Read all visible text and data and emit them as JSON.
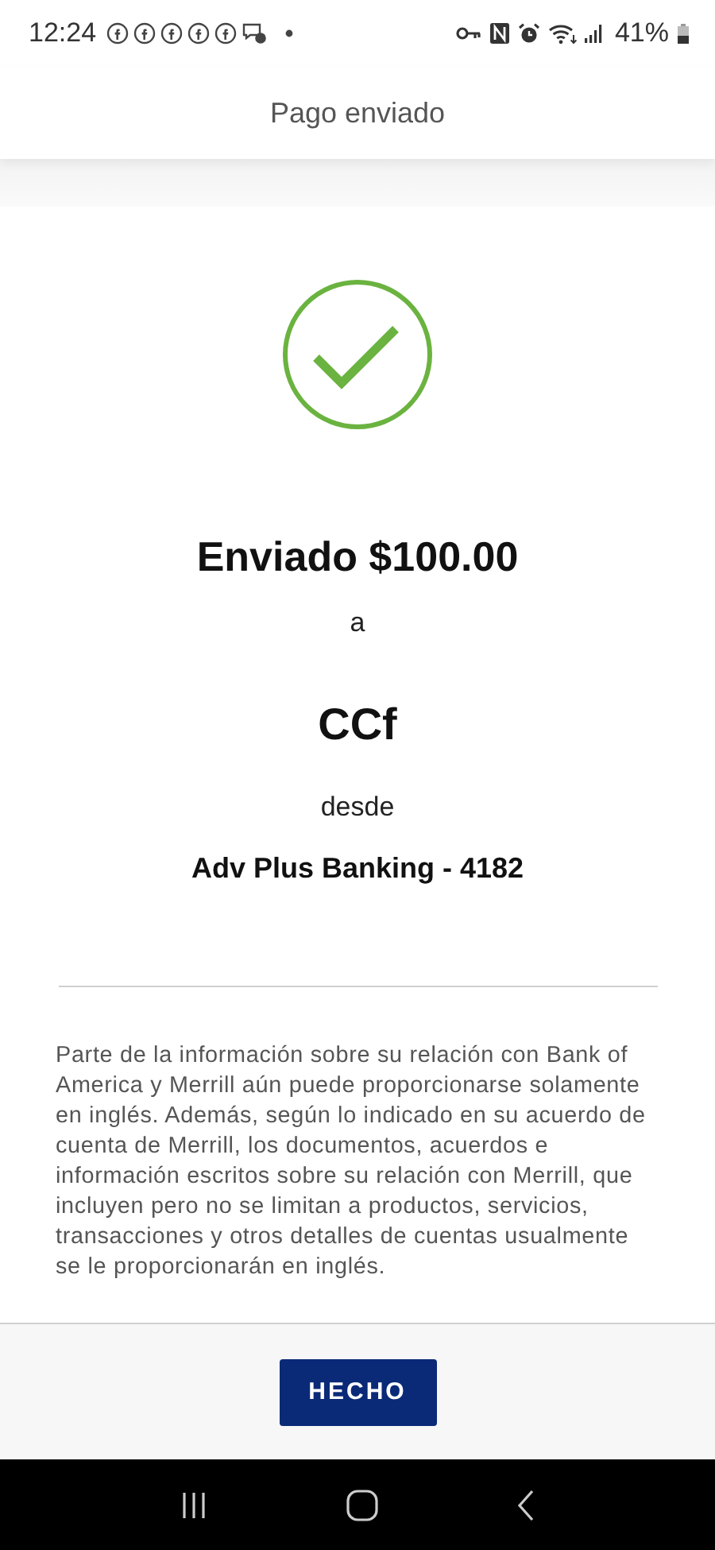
{
  "status_bar": {
    "time": "12:24",
    "battery": "41%"
  },
  "header": {
    "title": "Pago enviado"
  },
  "confirmation": {
    "amount_line": "Enviado $100.00",
    "to_label": "a",
    "recipient": "CCf",
    "from_label": "desde",
    "account": "Adv Plus Banking - 4182"
  },
  "disclaimer": "Parte de la información sobre su relación con Bank of America y Merrill aún puede proporcionarse solamente en inglés. Además, según lo indicado en su acuerdo de cuenta de Merrill, los documentos, acuerdos e información escritos sobre su relación con Merrill, que incluyen pero no se limitan a productos, servicios, transacciones y otros detalles de cuentas usualmente se le proporcionarán en inglés.",
  "footer": {
    "button": "HECHO"
  }
}
